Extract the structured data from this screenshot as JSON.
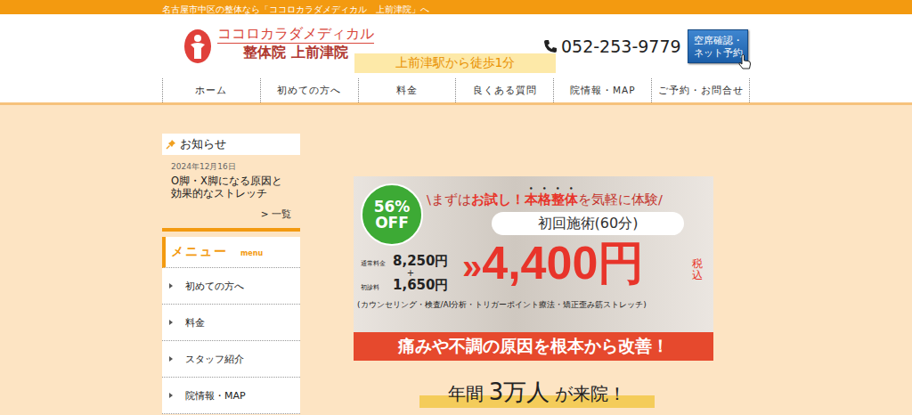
{
  "top_bar": {
    "text": "名古屋市中区の整体なら「ココロカラダメディカル　上前津院」へ"
  },
  "header": {
    "logo": {
      "name": "ココロカラダメディカル",
      "branch": "整体院 上前津院"
    },
    "access": "上前津駅から徒歩1分",
    "phone": "052-253-9779",
    "reserve_button": [
      "空席確認・",
      "ネット予約"
    ]
  },
  "nav": [
    {
      "label": "ホーム"
    },
    {
      "label": "初めての方へ"
    },
    {
      "label": "料金"
    },
    {
      "label": "良くある質問"
    },
    {
      "label": "院情報・MAP"
    },
    {
      "label": "ご予約・お問合せ"
    }
  ],
  "news": {
    "title": "お知らせ",
    "items": [
      {
        "date": "2024年12月16日",
        "title": "O脚・X脚になる原因と効果的なストレッチ"
      }
    ],
    "more": "> 一覧"
  },
  "menu": {
    "title": "メニュー",
    "subtitle": "menu",
    "items": [
      {
        "label": "初めての方へ"
      },
      {
        "label": "料金"
      },
      {
        "label": "スタッフ紹介"
      },
      {
        "label": "院情報・MAP"
      }
    ]
  },
  "banner": {
    "discount": {
      "percent": "56%",
      "word": "OFF"
    },
    "headline": [
      {
        "text": "\\まずは",
        "strong": false,
        "emphasis": false
      },
      {
        "text": "お試し！",
        "strong": true,
        "emphasis": false
      },
      {
        "text": "本格整体",
        "strong": true,
        "emphasis": true
      },
      {
        "text": "を気軽に体験/",
        "strong": false,
        "emphasis": false
      }
    ],
    "course": "初回施術(60分)",
    "regular_label": "通常料金",
    "regular_price": "8,250円",
    "plus": "+",
    "first_label": "初診料",
    "first_price": "1,650円",
    "arrow": "»",
    "price": "4,400円",
    "tax": "税込",
    "contents": "(カウンセリング・検査/AI分析・トリガーポイント療法・矯正歪み筋ストレッチ)",
    "slogan": "痛みや不調の原因を根本から改善！"
  },
  "tagline": {
    "prefix": "年間",
    "highlight": "3万人",
    "suffix": "が来院！"
  }
}
